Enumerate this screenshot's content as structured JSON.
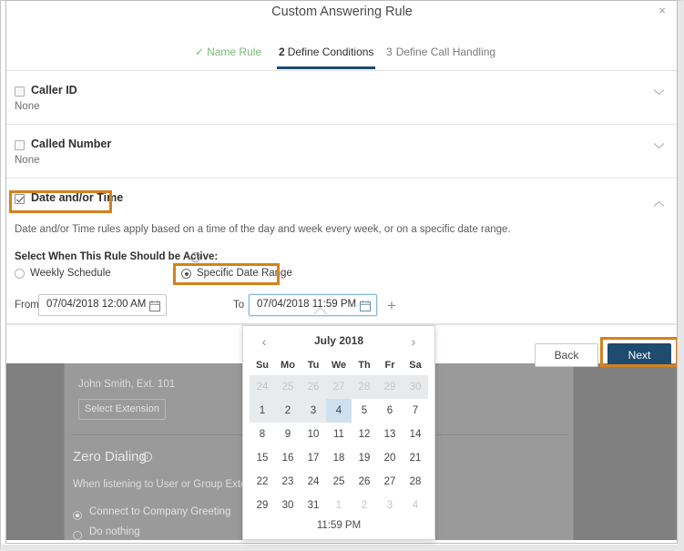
{
  "modal": {
    "title": "Custom Answering Rule",
    "close_label": "×",
    "steps": [
      {
        "marker": "✓",
        "label": "Name Rule"
      },
      {
        "marker": "2",
        "label": "Define Conditions"
      },
      {
        "marker": "3",
        "label": "Define Call Handling"
      }
    ],
    "sections": [
      {
        "label": "Caller ID",
        "value": "None",
        "checked": false,
        "chevron": "chevron-down-icon"
      },
      {
        "label": "Called Number",
        "value": "None",
        "checked": false,
        "chevron": "chevron-down-icon"
      },
      {
        "label": "Date and/or Time",
        "value": "",
        "checked": true,
        "chevron": "chevron-up-icon"
      }
    ],
    "date_time": {
      "description": "Date and/or Time rules apply based on a time of the day and week every week, or on a specific date range.",
      "active_label": "Select When This Rule Should be Active:",
      "info_icon": "info-icon",
      "options": [
        {
          "label": "Weekly Schedule",
          "selected": false
        },
        {
          "label": "Specific Date Range",
          "selected": true
        }
      ],
      "from_label": "From",
      "from_value": "07/04/2018 12:00 AM",
      "to_label": "To",
      "to_value": "07/04/2018 11:59 PM",
      "add_label": "+",
      "calendar_icon": "calendar-icon"
    },
    "footer": {
      "back_label": "Back",
      "next_label": "Next"
    }
  },
  "calendar": {
    "prev_label": "‹",
    "next_label": "›",
    "month_label": "July 2018",
    "day_names": [
      "Su",
      "Mo",
      "Tu",
      "We",
      "Th",
      "Fr",
      "Sa"
    ],
    "weeks": [
      [
        {
          "d": "24",
          "out": true,
          "band": true,
          "sel": false
        },
        {
          "d": "25",
          "out": true,
          "band": true,
          "sel": false
        },
        {
          "d": "26",
          "out": true,
          "band": true,
          "sel": false
        },
        {
          "d": "27",
          "out": true,
          "band": true,
          "sel": false
        },
        {
          "d": "28",
          "out": true,
          "band": true,
          "sel": false
        },
        {
          "d": "29",
          "out": true,
          "band": true,
          "sel": false
        },
        {
          "d": "30",
          "out": true,
          "band": true,
          "sel": false
        }
      ],
      [
        {
          "d": "1",
          "out": false,
          "band": true,
          "sel": false
        },
        {
          "d": "2",
          "out": false,
          "band": true,
          "sel": false
        },
        {
          "d": "3",
          "out": false,
          "band": true,
          "sel": false
        },
        {
          "d": "4",
          "out": false,
          "band": false,
          "sel": true
        },
        {
          "d": "5",
          "out": false,
          "band": false,
          "sel": false
        },
        {
          "d": "6",
          "out": false,
          "band": false,
          "sel": false
        },
        {
          "d": "7",
          "out": false,
          "band": false,
          "sel": false
        }
      ],
      [
        {
          "d": "8",
          "out": false,
          "band": false,
          "sel": false
        },
        {
          "d": "9",
          "out": false,
          "band": false,
          "sel": false
        },
        {
          "d": "10",
          "out": false,
          "band": false,
          "sel": false
        },
        {
          "d": "11",
          "out": false,
          "band": false,
          "sel": false
        },
        {
          "d": "12",
          "out": false,
          "band": false,
          "sel": false
        },
        {
          "d": "13",
          "out": false,
          "band": false,
          "sel": false
        },
        {
          "d": "14",
          "out": false,
          "band": false,
          "sel": false
        }
      ],
      [
        {
          "d": "15",
          "out": false,
          "band": false,
          "sel": false
        },
        {
          "d": "16",
          "out": false,
          "band": false,
          "sel": false
        },
        {
          "d": "17",
          "out": false,
          "band": false,
          "sel": false
        },
        {
          "d": "18",
          "out": false,
          "band": false,
          "sel": false
        },
        {
          "d": "19",
          "out": false,
          "band": false,
          "sel": false
        },
        {
          "d": "20",
          "out": false,
          "band": false,
          "sel": false
        },
        {
          "d": "21",
          "out": false,
          "band": false,
          "sel": false
        }
      ],
      [
        {
          "d": "22",
          "out": false,
          "band": false,
          "sel": false
        },
        {
          "d": "23",
          "out": false,
          "band": false,
          "sel": false
        },
        {
          "d": "24",
          "out": false,
          "band": false,
          "sel": false
        },
        {
          "d": "25",
          "out": false,
          "band": false,
          "sel": false
        },
        {
          "d": "26",
          "out": false,
          "band": false,
          "sel": false
        },
        {
          "d": "27",
          "out": false,
          "band": false,
          "sel": false
        },
        {
          "d": "28",
          "out": false,
          "band": false,
          "sel": false
        }
      ],
      [
        {
          "d": "29",
          "out": false,
          "band": false,
          "sel": false
        },
        {
          "d": "30",
          "out": false,
          "band": false,
          "sel": false
        },
        {
          "d": "31",
          "out": false,
          "band": false,
          "sel": false
        },
        {
          "d": "1",
          "out": true,
          "band": false,
          "sel": false
        },
        {
          "d": "2",
          "out": true,
          "band": false,
          "sel": false
        },
        {
          "d": "3",
          "out": true,
          "band": false,
          "sel": false
        },
        {
          "d": "4",
          "out": true,
          "band": false,
          "sel": false
        }
      ]
    ],
    "time_value": "11:59 PM"
  },
  "background": {
    "extension_text": "John Smith, Ext. 101",
    "select_extension_label": "Select Extension",
    "zero_dialing_title": "Zero Dialing",
    "zero_dialing_info_icon": "info-icon",
    "zero_dialing_desc": "When listening to User or Group Extension below.",
    "zero_dialing_options": [
      {
        "label": "Connect to Company Greeting",
        "selected": true
      },
      {
        "label": "Do nothing",
        "selected": false
      }
    ]
  },
  "colors": {
    "highlight_orange": "#d6811c",
    "primary_blue": "#1e4b6e",
    "selected_day": "#cfe0ef",
    "step_done_green": "#7ab87a"
  }
}
